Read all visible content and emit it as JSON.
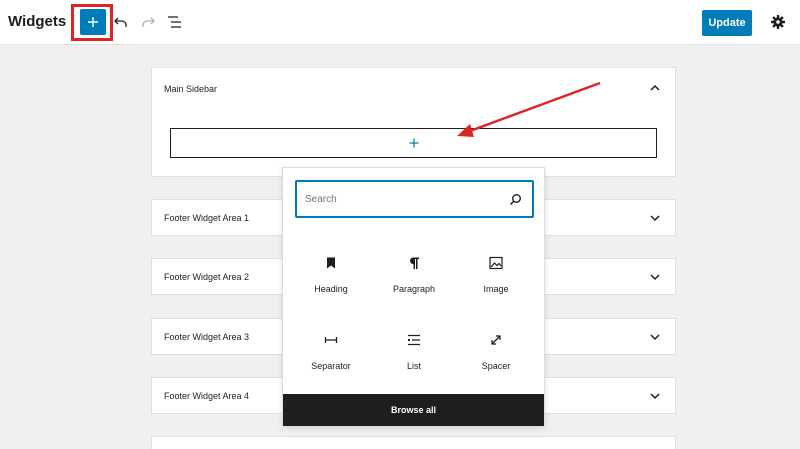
{
  "header": {
    "title": "Widgets",
    "update_label": "Update"
  },
  "areas": {
    "main": {
      "label": "Main Sidebar"
    },
    "footer1": {
      "label": "Footer Widget Area 1"
    },
    "footer2": {
      "label": "Footer Widget Area 2"
    },
    "footer3": {
      "label": "Footer Widget Area 3"
    },
    "footer4": {
      "label": "Footer Widget Area 4"
    }
  },
  "inserter": {
    "search_placeholder": "Search",
    "blocks": [
      {
        "label": "Heading",
        "icon": "bookmark-icon"
      },
      {
        "label": "Paragraph",
        "icon": "pilcrow-icon"
      },
      {
        "label": "Image",
        "icon": "image-icon"
      },
      {
        "label": "Separator",
        "icon": "separator-icon"
      },
      {
        "label": "List",
        "icon": "list-icon"
      },
      {
        "label": "Spacer",
        "icon": "spacer-icon"
      }
    ],
    "browse_all_label": "Browse all"
  },
  "colors": {
    "accent": "#007cba",
    "annotation": "#e02424",
    "dark": "#1e1e1e"
  }
}
